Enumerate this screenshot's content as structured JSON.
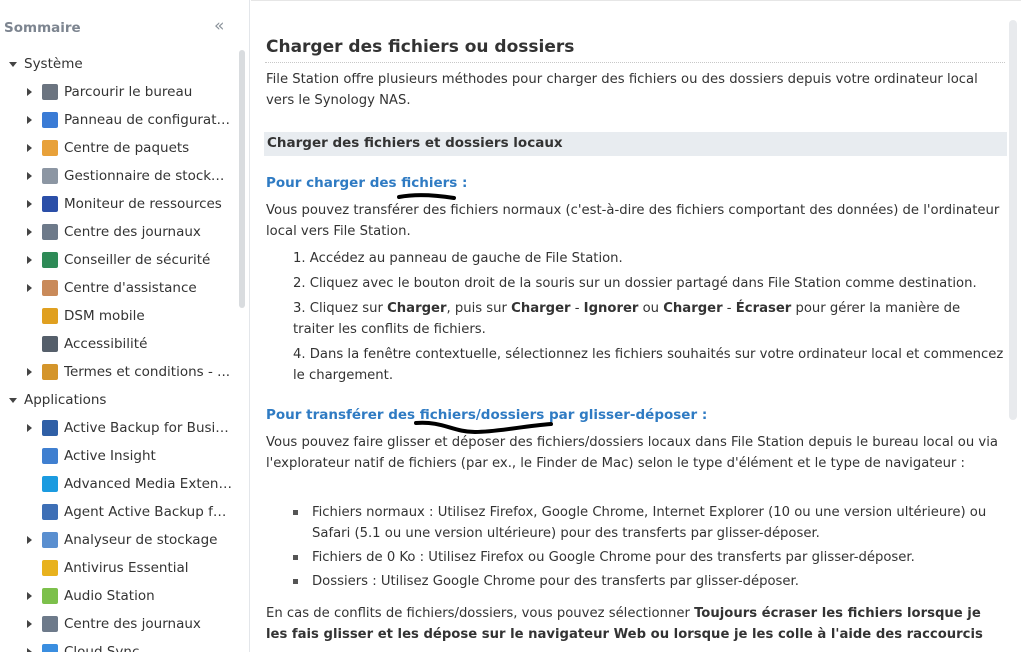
{
  "sidebar": {
    "title": "Sommaire",
    "collapse_icon": "«",
    "groups": [
      {
        "label": "Système"
      },
      {
        "label": "Applications"
      }
    ],
    "system_items": [
      {
        "label": "Parcourir le bureau",
        "icon": "desktop-icon",
        "color": "#6b7480"
      },
      {
        "label": "Panneau de configuration",
        "icon": "control-panel-icon",
        "color": "#3a7bd5"
      },
      {
        "label": "Centre de paquets",
        "icon": "package-icon",
        "color": "#e8a13a"
      },
      {
        "label": "Gestionnaire de stockage",
        "icon": "storage-icon",
        "color": "#8c96a3"
      },
      {
        "label": "Moniteur de ressources",
        "icon": "monitor-icon",
        "color": "#2b4fa8"
      },
      {
        "label": "Centre des journaux",
        "icon": "log-icon",
        "color": "#6d7a8a"
      },
      {
        "label": "Conseiller de sécurité",
        "icon": "security-icon",
        "color": "#2e8b57"
      },
      {
        "label": "Centre d'assistance",
        "icon": "support-icon",
        "color": "#c98a5a"
      },
      {
        "label": "DSM mobile",
        "icon": "mobile-icon",
        "color": "#e0a020"
      },
      {
        "label": "Accessibilité",
        "icon": "accessibility-icon",
        "color": "#555f6b"
      },
      {
        "label": "Termes et conditions - ...",
        "icon": "terms-icon",
        "color": "#d4952b"
      }
    ],
    "app_items": [
      {
        "label": "Active Backup for Busin...",
        "icon": "active-backup-icon",
        "color": "#2f5fa6"
      },
      {
        "label": "Active Insight",
        "icon": "active-insight-icon",
        "color": "#3f7fd0"
      },
      {
        "label": "Advanced Media Extens...",
        "icon": "media-extension-icon",
        "color": "#1b9be0"
      },
      {
        "label": "Agent Active Backup for...",
        "icon": "agent-backup-icon",
        "color": "#3d6fb6"
      },
      {
        "label": "Analyseur de stockage",
        "icon": "storage-analyzer-icon",
        "color": "#5a8fd0"
      },
      {
        "label": "Antivirus Essential",
        "icon": "antivirus-icon",
        "color": "#e8b21e"
      },
      {
        "label": "Audio Station",
        "icon": "audio-station-icon",
        "color": "#7cc04b"
      },
      {
        "label": "Centre des journaux",
        "icon": "log-icon",
        "color": "#6d7a8a"
      },
      {
        "label": "Cloud Sync",
        "icon": "cloud-sync-icon",
        "color": "#3a8ee0"
      }
    ]
  },
  "content": {
    "title": "Charger des fichiers ou dossiers",
    "intro": "File Station offre plusieurs méthodes pour charger des fichiers ou des dossiers depuis votre ordinateur local vers le Synology NAS.",
    "section_heading": "Charger des fichiers et dossiers locaux",
    "upload_heading": "Pour charger des fichiers :",
    "upload_intro": "Vous pouvez transférer des fichiers normaux (c'est-à-dire des fichiers comportant des données) de l'ordinateur local vers File Station.",
    "steps": {
      "s1": "1. Accédez au panneau de gauche de File Station.",
      "s2": "2. Cliquez avec le bouton droit de la souris sur un dossier partagé dans File Station comme destination.",
      "s3_a": "3. Cliquez sur ",
      "s3_b": "Charger",
      "s3_c": ", puis sur ",
      "s3_d": "Charger",
      "s3_e": " - ",
      "s3_f": "Ignorer",
      "s3_g": " ou ",
      "s3_h": "Charger",
      "s3_i": " - ",
      "s3_j": "Écraser",
      "s3_k": " pour gérer la manière de traiter les conflits de fichiers.",
      "s4": "4. Dans la fenêtre contextuelle, sélectionnez les fichiers souhaités sur votre ordinateur local et commencez le chargement."
    },
    "drag_heading": "Pour transférer des fichiers/dossiers par glisser-déposer :",
    "drag_intro": "Vous pouvez faire glisser et déposer des fichiers/dossiers locaux dans File Station depuis le bureau local ou via l'explorateur natif de fichiers (par ex., le Finder de Mac) selon le type d'élément et le type de navigateur :",
    "bullets": [
      "Fichiers normaux : Utilisez Firefox, Google Chrome, Internet Explorer (10 ou une version ultérieure) ou Safari (5.1 ou une version ultérieure) pour des transferts par glisser-déposer.",
      "Fichiers de 0 Ko : Utilisez Firefox ou Google Chrome pour des transferts par glisser-déposer.",
      "Dossiers : Utilisez Google Chrome pour des transferts par glisser-déposer."
    ],
    "conflict_a": "En cas de conflits de fichiers/dossiers, vous pouvez sélectionner ",
    "conflict_b": "Toujours écraser les fichiers lorsque je les fais glisser et les dépose sur le navigateur Web ou lorsque je les colle à l'aide des raccourcis"
  },
  "colors": {
    "link_blue": "#2f7bc3",
    "section_bg": "#e8ecf0",
    "annotation": "#000000"
  }
}
